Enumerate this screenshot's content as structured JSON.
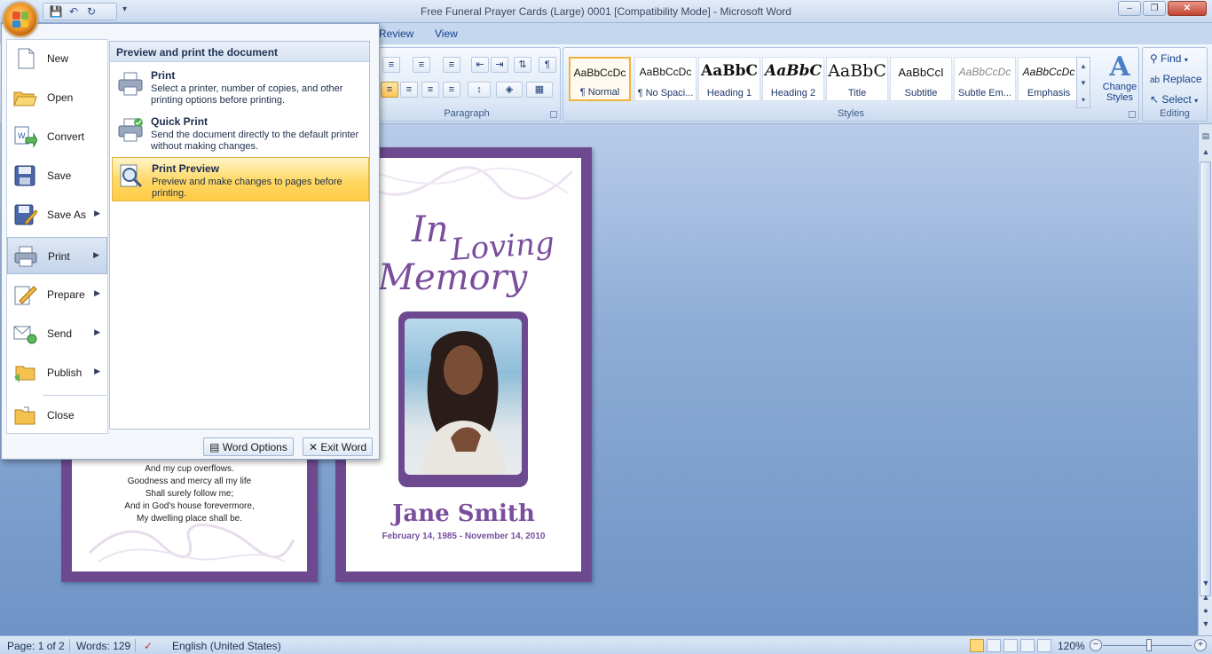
{
  "window": {
    "title": "Free Funeral Prayer Cards (Large) 0001 [Compatibility Mode] - Microsoft Word",
    "minimize": "‒",
    "maximize": "❐",
    "close": "✕"
  },
  "quick_access": [
    "save-icon",
    "undo-icon",
    "redo-icon"
  ],
  "ribbon": {
    "tabs": [
      "Review",
      "View"
    ],
    "paragraph_label": "Paragraph",
    "styles_label": "Styles",
    "editing_label": "Editing",
    "styles": [
      {
        "sample": "AaBbCcDc",
        "name": "¶ Normal",
        "selected": true
      },
      {
        "sample": "AaBbCcDc",
        "name": "¶ No Spaci..."
      },
      {
        "sample": "AaBbC",
        "name": "Heading 1"
      },
      {
        "sample": "AaBbC",
        "name": "Heading 2"
      },
      {
        "sample": "AaBbC",
        "name": "Title"
      },
      {
        "sample": "AaBbCcI",
        "name": "Subtitle"
      },
      {
        "sample": "AaBbCcDc",
        "name": "Subtle Em..."
      },
      {
        "sample": "AaBbCcDc",
        "name": "Emphasis"
      }
    ],
    "change_styles": "Change Styles",
    "editing": {
      "find": "Find",
      "replace": "Replace",
      "select": "Select"
    }
  },
  "office_menu": {
    "items": [
      {
        "label": "New",
        "icon": "new-document-icon"
      },
      {
        "label": "Open",
        "icon": "open-folder-icon"
      },
      {
        "label": "Convert",
        "icon": "convert-icon"
      },
      {
        "label": "Save",
        "icon": "save-icon"
      },
      {
        "label": "Save As",
        "icon": "save-as-icon"
      },
      {
        "label": "Print",
        "icon": "printer-icon"
      },
      {
        "label": "Prepare",
        "icon": "prepare-icon"
      },
      {
        "label": "Send",
        "icon": "send-icon"
      },
      {
        "label": "Publish",
        "icon": "publish-icon"
      },
      {
        "label": "Close",
        "icon": "close-folder-icon"
      }
    ],
    "submenu_header": "Preview and print the document",
    "submenu": [
      {
        "title": "Print",
        "desc": "Select a printer, number of copies, and other printing options before printing."
      },
      {
        "title": "Quick Print",
        "desc": "Send the document directly to the default printer without making changes."
      },
      {
        "title": "Print Preview",
        "desc": "Preview and make changes to pages before printing."
      }
    ],
    "word_options": "Word Options",
    "exit_word": "Exit Word"
  },
  "document": {
    "verse_lines": [
      "And my cup overflows.",
      "Goodness and mercy all my life",
      "Shall surely follow me;",
      "And in God's house forevermore,",
      "My dwelling place shall be."
    ],
    "heading_in": "In",
    "heading_loving": "Loving",
    "heading_memory": "Memory",
    "name": "Jane Smith",
    "dates": "February 14, 1985 - November 14, 2010"
  },
  "status": {
    "page": "Page: 1 of 2",
    "words": "Words: 129",
    "language": "English (United States)",
    "zoom": "120%",
    "zoom_out": "−",
    "zoom_in": "+"
  },
  "colors": {
    "accent_purple": "#6d4a8f",
    "text_purple": "#7a4e9c",
    "highlight": "#ffd863"
  }
}
